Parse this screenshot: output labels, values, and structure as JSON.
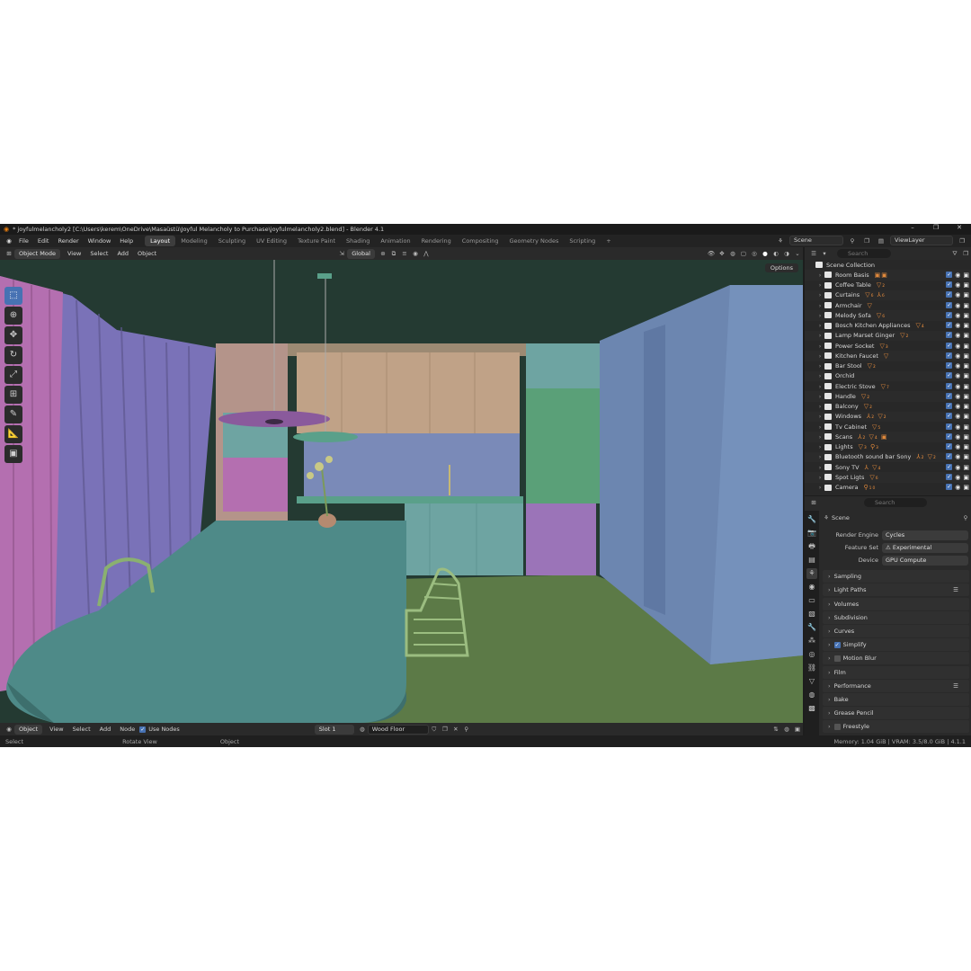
{
  "window": {
    "title": "* joyfulmelancholy2 [C:\\Users\\kerem\\OneDrive\\Masaüstü\\Joyful Melancholy to Purchase\\joyfulmelancholy2.blend] - Blender 4.1",
    "minimize": "–",
    "maximize": "❐",
    "close": "✕"
  },
  "menu": {
    "items": [
      "File",
      "Edit",
      "Render",
      "Window",
      "Help"
    ],
    "workspaces": [
      "Layout",
      "Modeling",
      "Sculpting",
      "UV Editing",
      "Texture Paint",
      "Shading",
      "Animation",
      "Rendering",
      "Compositing",
      "Geometry Nodes",
      "Scripting"
    ],
    "add_tab": "+",
    "scene": "Scene",
    "view_layer": "ViewLayer"
  },
  "viewport_header": {
    "mode": "Object Mode",
    "menus": [
      "View",
      "Select",
      "Add",
      "Object"
    ],
    "orientation": "Global",
    "options": "Options"
  },
  "bottom_header": {
    "editor": "Object",
    "menus": [
      "View",
      "Select",
      "Add",
      "Node"
    ],
    "use_nodes": "Use Nodes",
    "slot": "Slot 1",
    "material": "Wood Floor"
  },
  "status_bar": {
    "select": "Select",
    "rotate": "Rotate View",
    "object": "Object",
    "memory": "Memory: 1.04 GiB | VRAM: 3.5/8.0 GiB | 4.1.1"
  },
  "outliner": {
    "search_placeholder": "Search",
    "root": "Scene Collection",
    "items": [
      {
        "name": "Room Basis",
        "mods": "▣▣"
      },
      {
        "name": "Coffee Table",
        "mods": "▽₂"
      },
      {
        "name": "Curtains",
        "mods": "▽₆ ⅄₆"
      },
      {
        "name": "Armchair",
        "mods": "▽"
      },
      {
        "name": "Melody Sofa",
        "mods": "▽₆"
      },
      {
        "name": "Bosch Kitchen Appliances",
        "mods": "▽₄"
      },
      {
        "name": "Lamp Marset Ginger",
        "mods": "▽₂"
      },
      {
        "name": "Power Socket",
        "mods": "▽₃"
      },
      {
        "name": "Kitchen Faucet",
        "mods": "▽"
      },
      {
        "name": "Bar Stool",
        "mods": "▽₂"
      },
      {
        "name": "Orchid",
        "mods": ""
      },
      {
        "name": "Electric Stove",
        "mods": "▽₇"
      },
      {
        "name": "Handle",
        "mods": "▽₂"
      },
      {
        "name": "Balcony",
        "mods": "▽₂"
      },
      {
        "name": "Windows",
        "mods": "⅄₂ ▽₂"
      },
      {
        "name": "Tv Cabinet",
        "mods": "▽₅"
      },
      {
        "name": "Scans",
        "mods": "⅄₂ ▽₄ ▣"
      },
      {
        "name": "Lights",
        "mods": "▽₃ ⚲₃"
      },
      {
        "name": "Bluetooth sound bar Sony",
        "mods": "⅄₂ ▽₂"
      },
      {
        "name": "Sony TV",
        "mods": "⅄ ▽₄"
      },
      {
        "name": "Spot Ligts",
        "mods": "▽₆"
      },
      {
        "name": "Camera",
        "mods": "⚲₁₀"
      }
    ]
  },
  "properties": {
    "search_placeholder": "Search",
    "context": "Scene",
    "fields": [
      {
        "label": "Render Engine",
        "value": "Cycles"
      },
      {
        "label": "Feature Set",
        "value": "⚠ Experimental"
      },
      {
        "label": "Device",
        "value": "GPU Compute"
      }
    ],
    "panels": [
      {
        "name": "Sampling",
        "check": null,
        "extra": ""
      },
      {
        "name": "Light Paths",
        "check": null,
        "extra": "☰"
      },
      {
        "name": "Volumes",
        "check": null,
        "extra": ""
      },
      {
        "name": "Subdivision",
        "check": null,
        "extra": ""
      },
      {
        "name": "Curves",
        "check": null,
        "extra": ""
      },
      {
        "name": "Simplify",
        "check": true,
        "extra": ""
      },
      {
        "name": "Motion Blur",
        "check": false,
        "extra": ""
      },
      {
        "name": "Film",
        "check": null,
        "extra": ""
      },
      {
        "name": "Performance",
        "check": null,
        "extra": "☰"
      },
      {
        "name": "Bake",
        "check": null,
        "extra": ""
      },
      {
        "name": "Grease Pencil",
        "check": null,
        "extra": ""
      },
      {
        "name": "Freestyle",
        "check": false,
        "extra": ""
      }
    ]
  },
  "colors": {
    "accent": "#4772b3",
    "blender_orange": "#e87d0d",
    "curtain_purple": "#7a72b8",
    "curtain_pink": "#b46fb0",
    "table_teal": "#4e8a88",
    "floor_green": "#5c7a47",
    "wall_dark": "#243a32",
    "pillar_blue": "#6c86b0"
  }
}
